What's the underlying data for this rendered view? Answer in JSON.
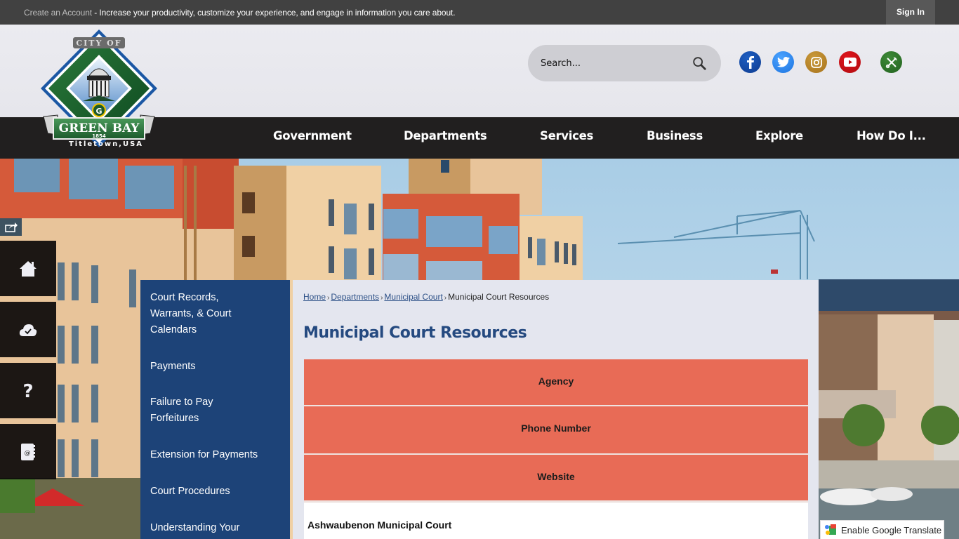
{
  "topbar": {
    "create_account_link": "Create an Account",
    "message": " - Increase your productivity, customize your experience, and engage in information you care about.",
    "sign_in_label": "Sign In"
  },
  "header": {
    "logo": {
      "top_text": "CITY OF",
      "city_name": "GREEN BAY",
      "year": "1854",
      "tagline": "Titletown,USA"
    },
    "search": {
      "placeholder": "Search..."
    },
    "social_icons": [
      {
        "name": "facebook-icon",
        "color": "#0e3b8f"
      },
      {
        "name": "twitter-icon",
        "color": "#1d74e0"
      },
      {
        "name": "instagram-icon",
        "color": "#a8731d"
      },
      {
        "name": "youtube-icon",
        "color": "#b00b10"
      },
      {
        "name": "tools-icon",
        "color": "#23621f"
      }
    ]
  },
  "nav": {
    "items": [
      {
        "label": "Government"
      },
      {
        "label": "Departments"
      },
      {
        "label": "Services"
      },
      {
        "label": "Business"
      },
      {
        "label": "Explore"
      },
      {
        "label": "How Do I..."
      }
    ]
  },
  "quick_links": [
    {
      "icon": "home-icon"
    },
    {
      "icon": "cloud-check-icon"
    },
    {
      "icon": "question-icon"
    },
    {
      "icon": "contact-book-icon"
    }
  ],
  "subnav": {
    "items": [
      {
        "label": "Court Records, Warrants, & Court Calendars"
      },
      {
        "label": "Payments"
      },
      {
        "label": "Failure to Pay Forfeitures"
      },
      {
        "label": "Extension for Payments"
      },
      {
        "label": "Court Procedures"
      },
      {
        "label": "Understanding Your"
      }
    ]
  },
  "breadcrumb": {
    "items": [
      {
        "label": "Home",
        "link": true
      },
      {
        "label": "Departments",
        "link": true
      },
      {
        "label": "Municipal Court",
        "link": true
      },
      {
        "label": "Municipal Court Resources",
        "link": false
      }
    ],
    "separator": "›"
  },
  "page": {
    "title": "Municipal Court Resources"
  },
  "table": {
    "headers": [
      "Agency",
      "Phone Number",
      "Website"
    ],
    "rows": [
      {
        "agency": "Ashwaubenon Municipal Court"
      }
    ],
    "header_color": "#e86b56"
  },
  "translate": {
    "label": "Enable Google Translate"
  },
  "colors": {
    "topbar": "#414141",
    "nav": "#211f1f",
    "subnav": "#1d4378",
    "title": "#254a80",
    "link": "#2b4f86"
  }
}
